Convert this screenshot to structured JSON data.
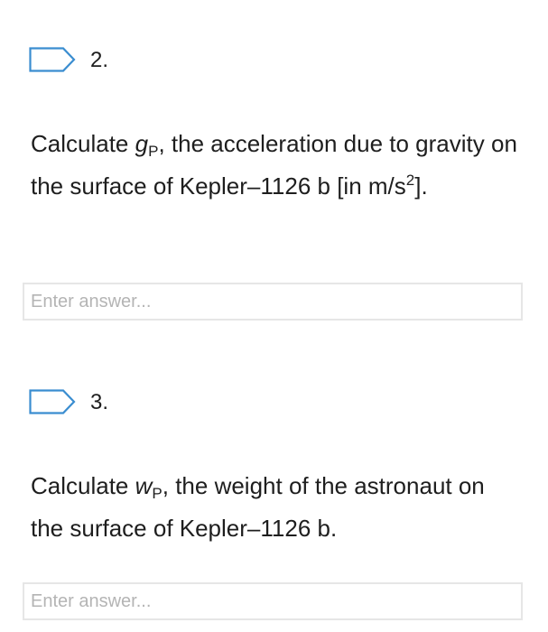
{
  "questions": [
    {
      "number": "2.",
      "text_before": "Calculate ",
      "variable": "g",
      "subscript": "P",
      "text_after": ", the acceleration due to gravity on the surface of Kepler–1126 b [in m/s",
      "superscript": "2",
      "text_end": "].",
      "answer_placeholder": "Enter answer..."
    },
    {
      "number": "3.",
      "text_before": "Calculate ",
      "variable": "w",
      "subscript": "P",
      "text_after": ", the weight of the astronaut on the surface of Kepler–1126 b.",
      "answer_placeholder": "Enter answer..."
    }
  ],
  "colors": {
    "flag_outline": "#3a8dd0",
    "input_border": "#e6e6e6",
    "placeholder": "#b4b4b4",
    "text": "#1e1e1e"
  },
  "icons": {
    "flag": "bookmark-flag-icon"
  }
}
